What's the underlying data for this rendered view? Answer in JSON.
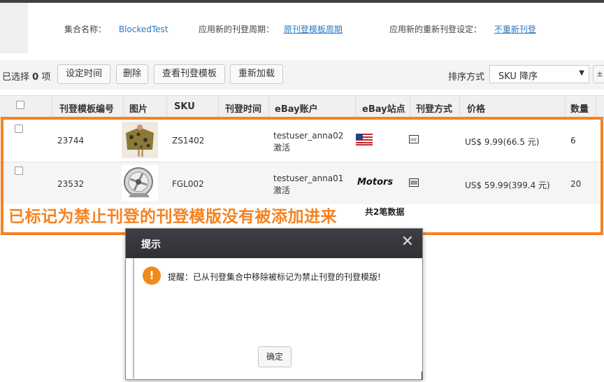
{
  "info": {
    "collection_label": "集合名称：",
    "collection_value": "BlockedTest",
    "cycle_label": "应用新的刊登周期：",
    "cycle_value": "原刊登模板周期",
    "relist_label": "应用新的重新刊登设定：",
    "relist_value": "不重新刊登"
  },
  "toolbar": {
    "selected_prefix": "已选择",
    "selected_count": "0",
    "selected_suffix": "项",
    "set_time": "设定时间",
    "delete": "删除",
    "view_template": "查看刊登模板",
    "reload": "重新加载",
    "sort_label": "排序方式",
    "sort_value": "SKU 降序"
  },
  "table": {
    "headers": [
      "刊登模板编号",
      "图片",
      "SKU",
      "刊登时间",
      "eBay账户",
      "eBay站点",
      "刊登方式",
      "价格",
      "数量"
    ],
    "rows": [
      {
        "template_id": "23744",
        "sku": "ZS1402",
        "account": "testuser_anna02",
        "status": "激活",
        "site_icon": "us-flag-icon",
        "listing_icon": "multi-variation-icon",
        "price": "US$ 9.99(66.5 元)",
        "quantity": "6"
      },
      {
        "template_id": "23532",
        "sku": "FGL002",
        "account": "testuser_anna01",
        "status": "激活",
        "site_label": "Motors",
        "listing_icon": "fixed-price-icon",
        "price": "US$ 59.99(399.4 元)",
        "quantity": "20"
      }
    ],
    "total": "共2笔数据"
  },
  "annotation": "已标记为禁止刊登的刊登模版没有被添加进来",
  "dialog": {
    "title": "提示",
    "message": "提醒：已从刊登集合中移除被标记为禁止刊登的刊登模版!",
    "ok": "确定"
  },
  "colors": {
    "highlight": "#f58220",
    "link": "#2b78c4",
    "dialog_header": "#35363a"
  }
}
